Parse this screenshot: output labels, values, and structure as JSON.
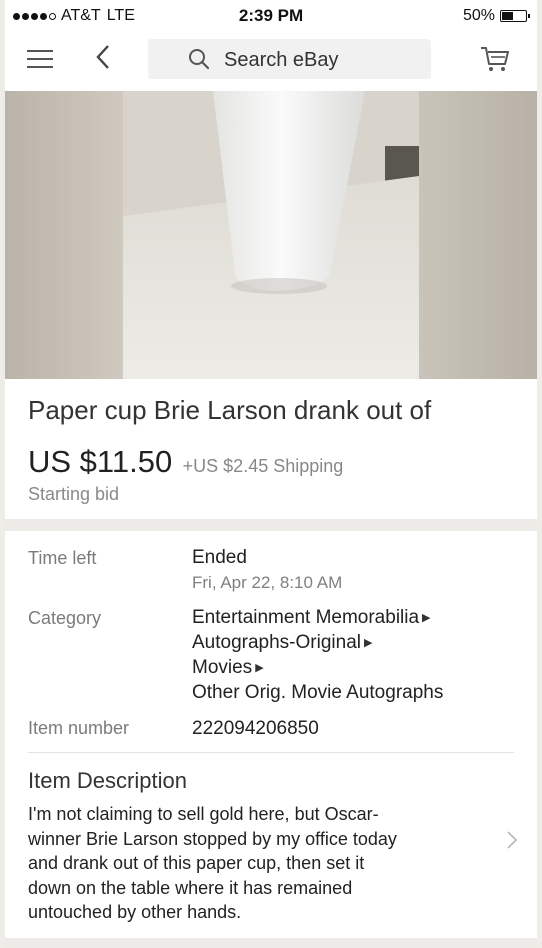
{
  "status_bar": {
    "carrier": "AT&T",
    "network": "LTE",
    "time": "2:39 PM",
    "battery": "50%",
    "battery_level": 0.5
  },
  "nav": {
    "search_placeholder": "Search eBay"
  },
  "listing": {
    "title": "Paper cup Brie Larson drank out of",
    "price": "US $11.50",
    "shipping": "+US $2.45 Shipping",
    "bid_label": "Starting bid"
  },
  "details": {
    "time_left_label": "Time left",
    "time_left_value": "Ended",
    "end_date": "Fri, Apr 22, 8:10 AM",
    "category_label": "Category",
    "categories": [
      "Entertainment Memorabilia",
      "Autographs-Original",
      "Movies",
      "Other Orig. Movie Autographs"
    ],
    "item_number_label": "Item number",
    "item_number": "222094206850"
  },
  "description": {
    "heading": "Item Description",
    "lines": [
      "I'm not claiming to sell gold here, but Oscar-",
      "winner Brie Larson stopped by my office today",
      "and drank out of this paper cup, then set it",
      "down on the table where it has remained",
      "untouched by other hands."
    ]
  }
}
